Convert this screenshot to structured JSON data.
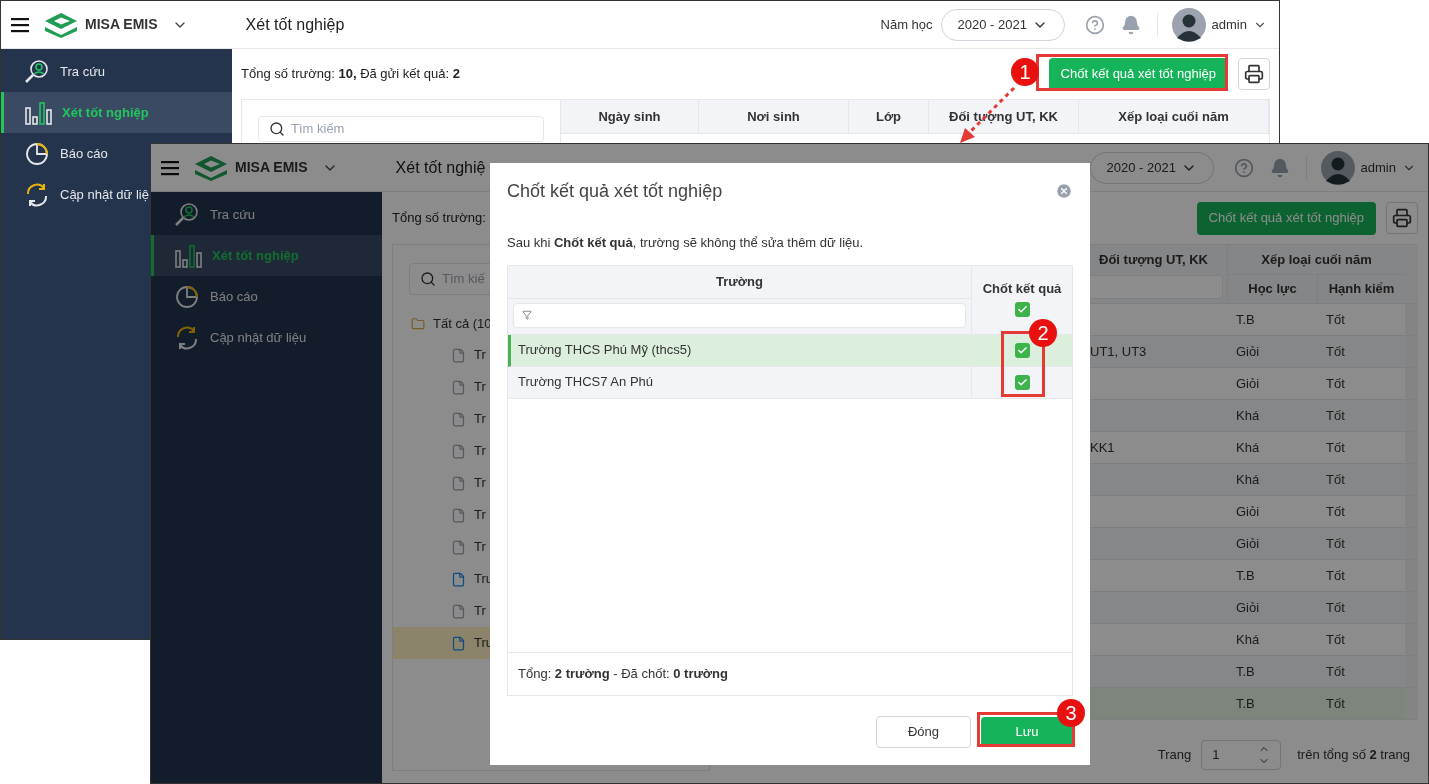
{
  "back_window": {
    "app_name": "MISA EMIS",
    "page_title": "Xét tốt nghiệp",
    "school_year_label": "Năm học",
    "school_year": "2020 - 2021",
    "user": "admin",
    "nav": [
      {
        "label": "Tra cứu",
        "selected": false
      },
      {
        "label": "Xét tốt nghiệp",
        "selected": true
      },
      {
        "label": "Báo cáo",
        "selected": false
      },
      {
        "label": "Cập nhật dữ liệ",
        "selected": false
      }
    ],
    "summary": "Tổng số trường: **10,** Đã gửi kết quả: **2**",
    "lock_button": "Chốt kết quả xét tốt nghiệp",
    "search_placeholder": "Tìm kiếm",
    "columns": [
      "Ngày sinh",
      "Nơi sinh",
      "Lớp",
      "Đối tượng UT, KK",
      "Xếp loại cuối năm"
    ]
  },
  "front_window": {
    "app_name": "MISA EMIS",
    "page_title": "Xét tốt nghiệ",
    "school_year": "2020 - 2021",
    "user": "admin",
    "nav": [
      {
        "label": "Tra cứu",
        "selected": false
      },
      {
        "label": "Xét tốt nghiệp",
        "selected": true
      },
      {
        "label": "Báo cáo",
        "selected": false
      },
      {
        "label": "Cập nhật dữ liệu",
        "selected": false
      }
    ],
    "summary": "Tổng số trường:",
    "lock_button": "Chốt kết quả xét tốt nghiệp",
    "search_placeholder": "Tìm kiế",
    "tree": {
      "label": "Tất cả (10",
      "children": [
        {
          "label": "Tr",
          "sent": false,
          "selected": false
        },
        {
          "label": "Tr",
          "sent": false,
          "selected": false
        },
        {
          "label": "Tr",
          "sent": false,
          "selected": false
        },
        {
          "label": "Tr",
          "sent": false,
          "selected": false
        },
        {
          "label": "Tr",
          "sent": false,
          "selected": false
        },
        {
          "label": "Tr",
          "sent": false,
          "selected": false
        },
        {
          "label": "Tr",
          "sent": false,
          "selected": false
        },
        {
          "label": "Tru",
          "sent": true,
          "selected": false
        },
        {
          "label": "Tr",
          "sent": false,
          "selected": false
        },
        {
          "label": "Tru",
          "sent": true,
          "selected": true
        }
      ]
    },
    "columns": {
      "target": "Đối tượng UT, KK",
      "ranking": "Xếp loại cuối năm",
      "academic": "Học lực",
      "conduct": "Hạnh kiểm"
    },
    "rows": [
      {
        "academic": "T.B",
        "conduct": "Tốt",
        "selected": false
      },
      {
        "target": "UT1, UT3",
        "academic": "Giỏi",
        "conduct": "Tốt",
        "selected": false
      },
      {
        "academic": "Giỏi",
        "conduct": "Tốt",
        "selected": false
      },
      {
        "academic": "Khá",
        "conduct": "Tốt",
        "selected": false
      },
      {
        "target": "KK1",
        "academic": "Khá",
        "conduct": "Tốt",
        "selected": false
      },
      {
        "academic": "Khá",
        "conduct": "Tốt",
        "selected": false
      },
      {
        "academic": "Giỏi",
        "conduct": "Tốt",
        "selected": false
      },
      {
        "academic": "Giỏi",
        "conduct": "Tốt",
        "selected": false
      },
      {
        "academic": "T.B",
        "conduct": "Tốt",
        "selected": false
      },
      {
        "academic": "Giỏi",
        "conduct": "Tốt",
        "selected": false
      },
      {
        "academic": "Khá",
        "conduct": "Tốt",
        "selected": false
      },
      {
        "academic": "T.B",
        "conduct": "Tốt",
        "selected": false
      },
      {
        "academic": "T.B",
        "conduct": "Tốt",
        "selected": true
      }
    ],
    "pagination": {
      "label": "Trang",
      "page": "1",
      "total": "trên tổng số **2** trang"
    }
  },
  "dialog": {
    "title": "Chốt kết quả xét tốt nghiệp",
    "description": "Sau khi **Chốt kết quả**, trường sẽ không thể sửa thêm dữ liệu.",
    "column_school": "Trường",
    "column_lock": "Chốt kết quả",
    "check_all": true,
    "rows": [
      {
        "school": "Trường THCS Phú Mỹ (thcs5)",
        "checked": true,
        "selected": true
      },
      {
        "school": "Trường THCS7 An Phú",
        "checked": true,
        "selected": false
      }
    ],
    "footer": "Tổng: **2 trường** - Đã chốt: **0 trường**",
    "close_button": "Đóng",
    "save_button": "Lưu"
  },
  "callouts": [
    "1",
    "2",
    "3"
  ]
}
